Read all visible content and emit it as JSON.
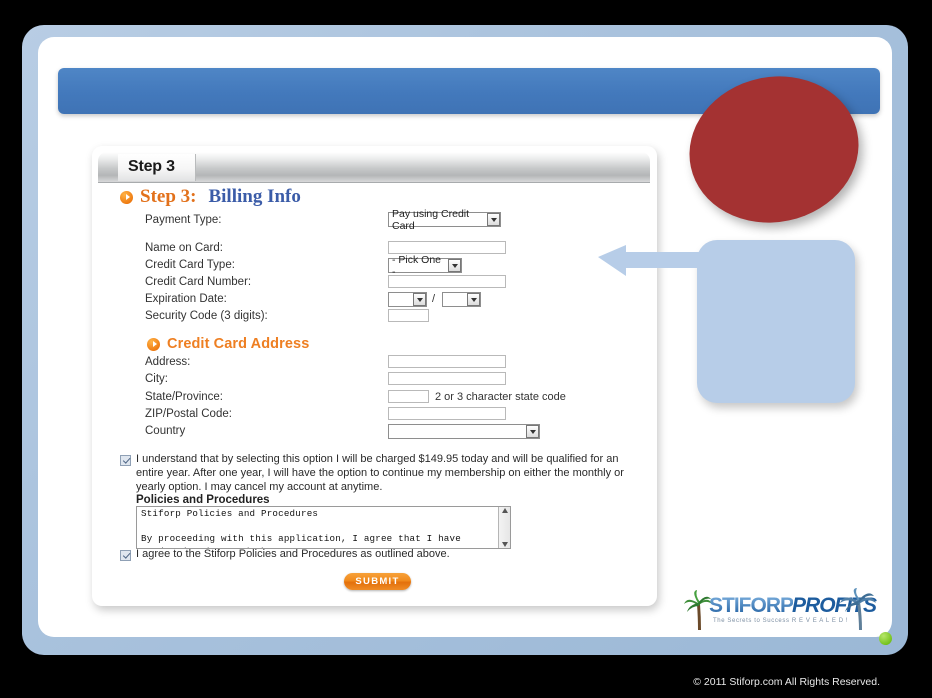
{
  "window": {
    "banner_label": "",
    "status_dot": "green"
  },
  "panel": {
    "tab_label": "Step 3",
    "heading_step": "Step 3:",
    "heading_title": "Billing Info",
    "address_heading": "Credit Card Address"
  },
  "billing_form": {
    "payment_type": {
      "label": "Payment Type:",
      "value": "Pay using Credit Card"
    },
    "name_on_card": {
      "label": "Name on Card:",
      "value": ""
    },
    "credit_card_type": {
      "label": "Credit Card Type:",
      "value": "- Pick One -"
    },
    "credit_card_number": {
      "label": "Credit Card Number:",
      "value": ""
    },
    "expiration_date": {
      "label": "Expiration Date:",
      "month_value": "",
      "year_value": "",
      "separator": "/"
    },
    "security_code": {
      "label": "Security Code (3 digits):",
      "value": ""
    }
  },
  "address_form": {
    "address": {
      "label": "Address:",
      "value": ""
    },
    "city": {
      "label": "City:",
      "value": ""
    },
    "state": {
      "label": "State/Province:",
      "value": "",
      "hint": "2 or 3 character state code"
    },
    "zip": {
      "label": "ZIP/Postal Code:",
      "value": ""
    },
    "country": {
      "label": "Country",
      "value": ""
    }
  },
  "agreements": {
    "charge_agreement": "I understand that by selecting this option I will be charged $149.95 today and will be qualified for an entire year. After one year, I will have the option to continue my membership on either the monthly or yearly option. I may cancel my account at anytime.",
    "charge_checked": true,
    "policies_title": "Policies and Procedures",
    "policies_text": "Stiforp Policies and Procedures\n\nBy proceeding with this application, I agree that I have\nread and understand these statements.",
    "policies_agreement": "I agree to the Stiforp Policies and Procedures as outlined above.",
    "policies_checked": true
  },
  "submit": {
    "label": "SUBMIT"
  },
  "logo": {
    "brand_first": "STIFORP",
    "brand_second": "PROFITS",
    "tagline": "The Secrets to Success  R E V E A L E D !"
  },
  "footer": {
    "copyright": "© 2011 Stiforp.com All Rights Reserved."
  },
  "colors": {
    "banner_blue": "#4379bc",
    "annotation_red": "#a43232",
    "annotation_blue": "#b7cde8",
    "accent_orange": "#ee7f22",
    "heading_blue": "#3b5ca8",
    "status_green": "#76c31f"
  }
}
